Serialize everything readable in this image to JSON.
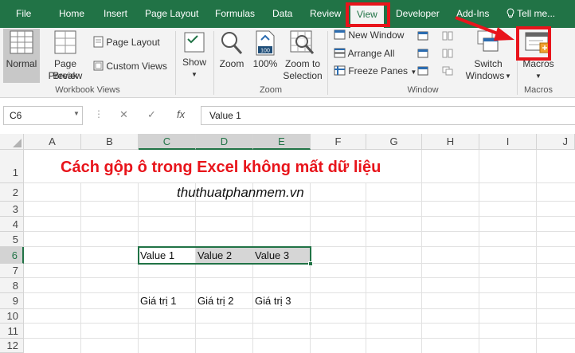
{
  "tabs": [
    "File",
    "Home",
    "Insert",
    "Page Layout",
    "Formulas",
    "Data",
    "Review",
    "View",
    "Developer",
    "Add-Ins"
  ],
  "active_tab": "View",
  "tell_me": "Tell me...",
  "ribbon": {
    "workbook_views": {
      "normal": "Normal",
      "page_break_1": "Page Break",
      "page_break_2": "Preview",
      "page_layout": "Page Layout",
      "custom_views": "Custom Views",
      "label": "Workbook Views"
    },
    "show": {
      "label": "Show"
    },
    "zoom": {
      "zoom": "Zoom",
      "zoom100": "100%",
      "zoom_sel_1": "Zoom to",
      "zoom_sel_2": "Selection",
      "label": "Zoom",
      "badge": "100"
    },
    "window": {
      "new_window": "New Window",
      "arrange_all": "Arrange All",
      "freeze_panes": "Freeze Panes",
      "switch_1": "Switch",
      "switch_2": "Windows",
      "label": "Window"
    },
    "macros": {
      "button": "Macros",
      "label": "Macros"
    }
  },
  "formula_bar": {
    "name_box": "C6",
    "fx": "fx",
    "formula": "Value 1"
  },
  "columns": [
    "A",
    "B",
    "C",
    "D",
    "E",
    "F",
    "G",
    "H",
    "I",
    "J"
  ],
  "rows": [
    "1",
    "2",
    "3",
    "4",
    "5",
    "6",
    "7",
    "8",
    "9",
    "10",
    "11",
    "12"
  ],
  "sheet": {
    "title": "Cách gộp ô trong Excel không mất dữ liệu",
    "subtitle": "thuthuatphanmem.vn",
    "row6": [
      "Value 1",
      "Value 2",
      "Value 3"
    ],
    "row9": [
      "Giá trị 1",
      "Giá trị 2",
      "Giá trị 3"
    ]
  },
  "colors": {
    "excel_green": "#217346",
    "highlight_red": "#e8141b"
  }
}
